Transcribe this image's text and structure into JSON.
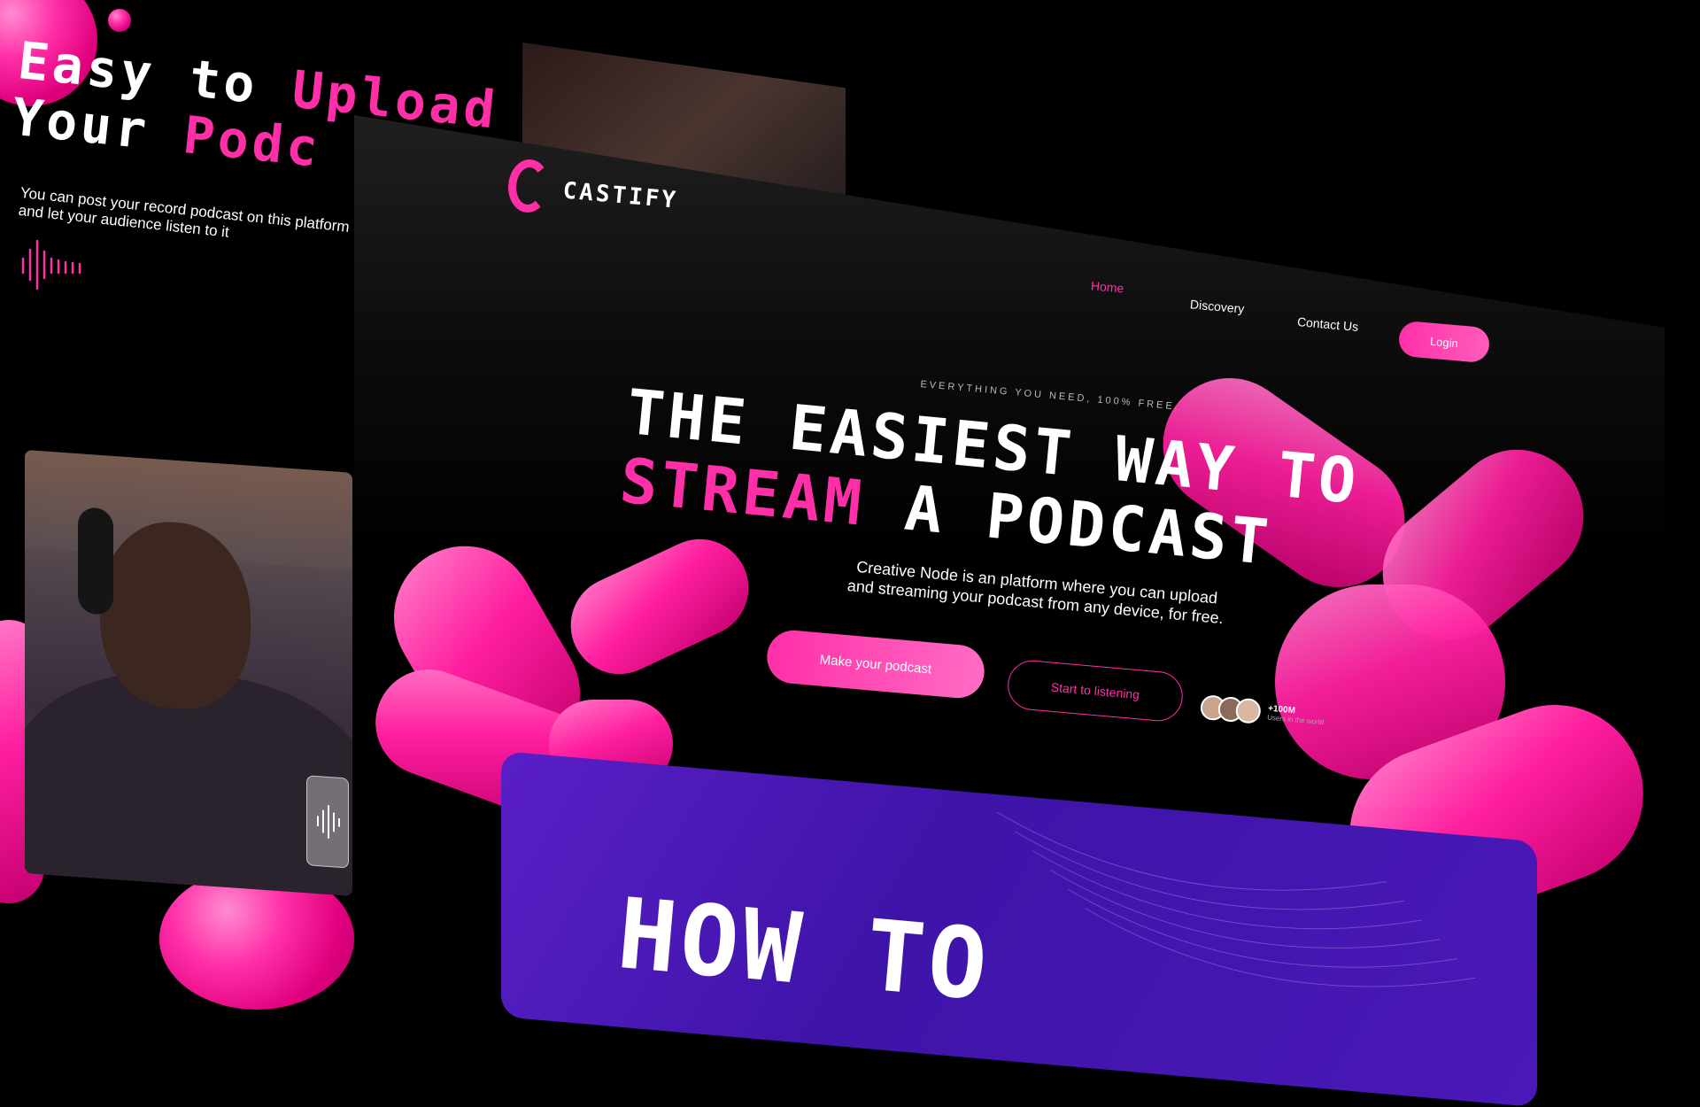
{
  "colors": {
    "accent": "#ff2fa8",
    "background": "#000000",
    "how_panel": "#4a19b8"
  },
  "left_panel": {
    "heading": {
      "line1_white": "Easy to ",
      "line1_pink": "Upload",
      "line2_white": "Your ",
      "line2_pink": "Podc"
    },
    "description": "You can post your record podcast on this platform and let your audience listen to it",
    "icon": "sound-wave-icon"
  },
  "site": {
    "logo_text": "CASTIFY",
    "nav": {
      "home": "Home",
      "discovery": "Discovery",
      "contact": "Contact Us",
      "login": "Login"
    },
    "tagline": "EVERYTHING YOU NEED, 100% FREE.",
    "hero": {
      "line1": "THE EASIEST WAY TO",
      "line2_pink": "STREAM",
      "line2_white": " A PODCAST",
      "description": "Creative Node is an platform where you can upload and streaming your podcast from any device, for free."
    },
    "cta": {
      "primary": "Make your podcast",
      "secondary": "Start to listening"
    },
    "users": {
      "count": "+100M",
      "label": "Users in the world"
    },
    "section_title": "HOW TO"
  }
}
